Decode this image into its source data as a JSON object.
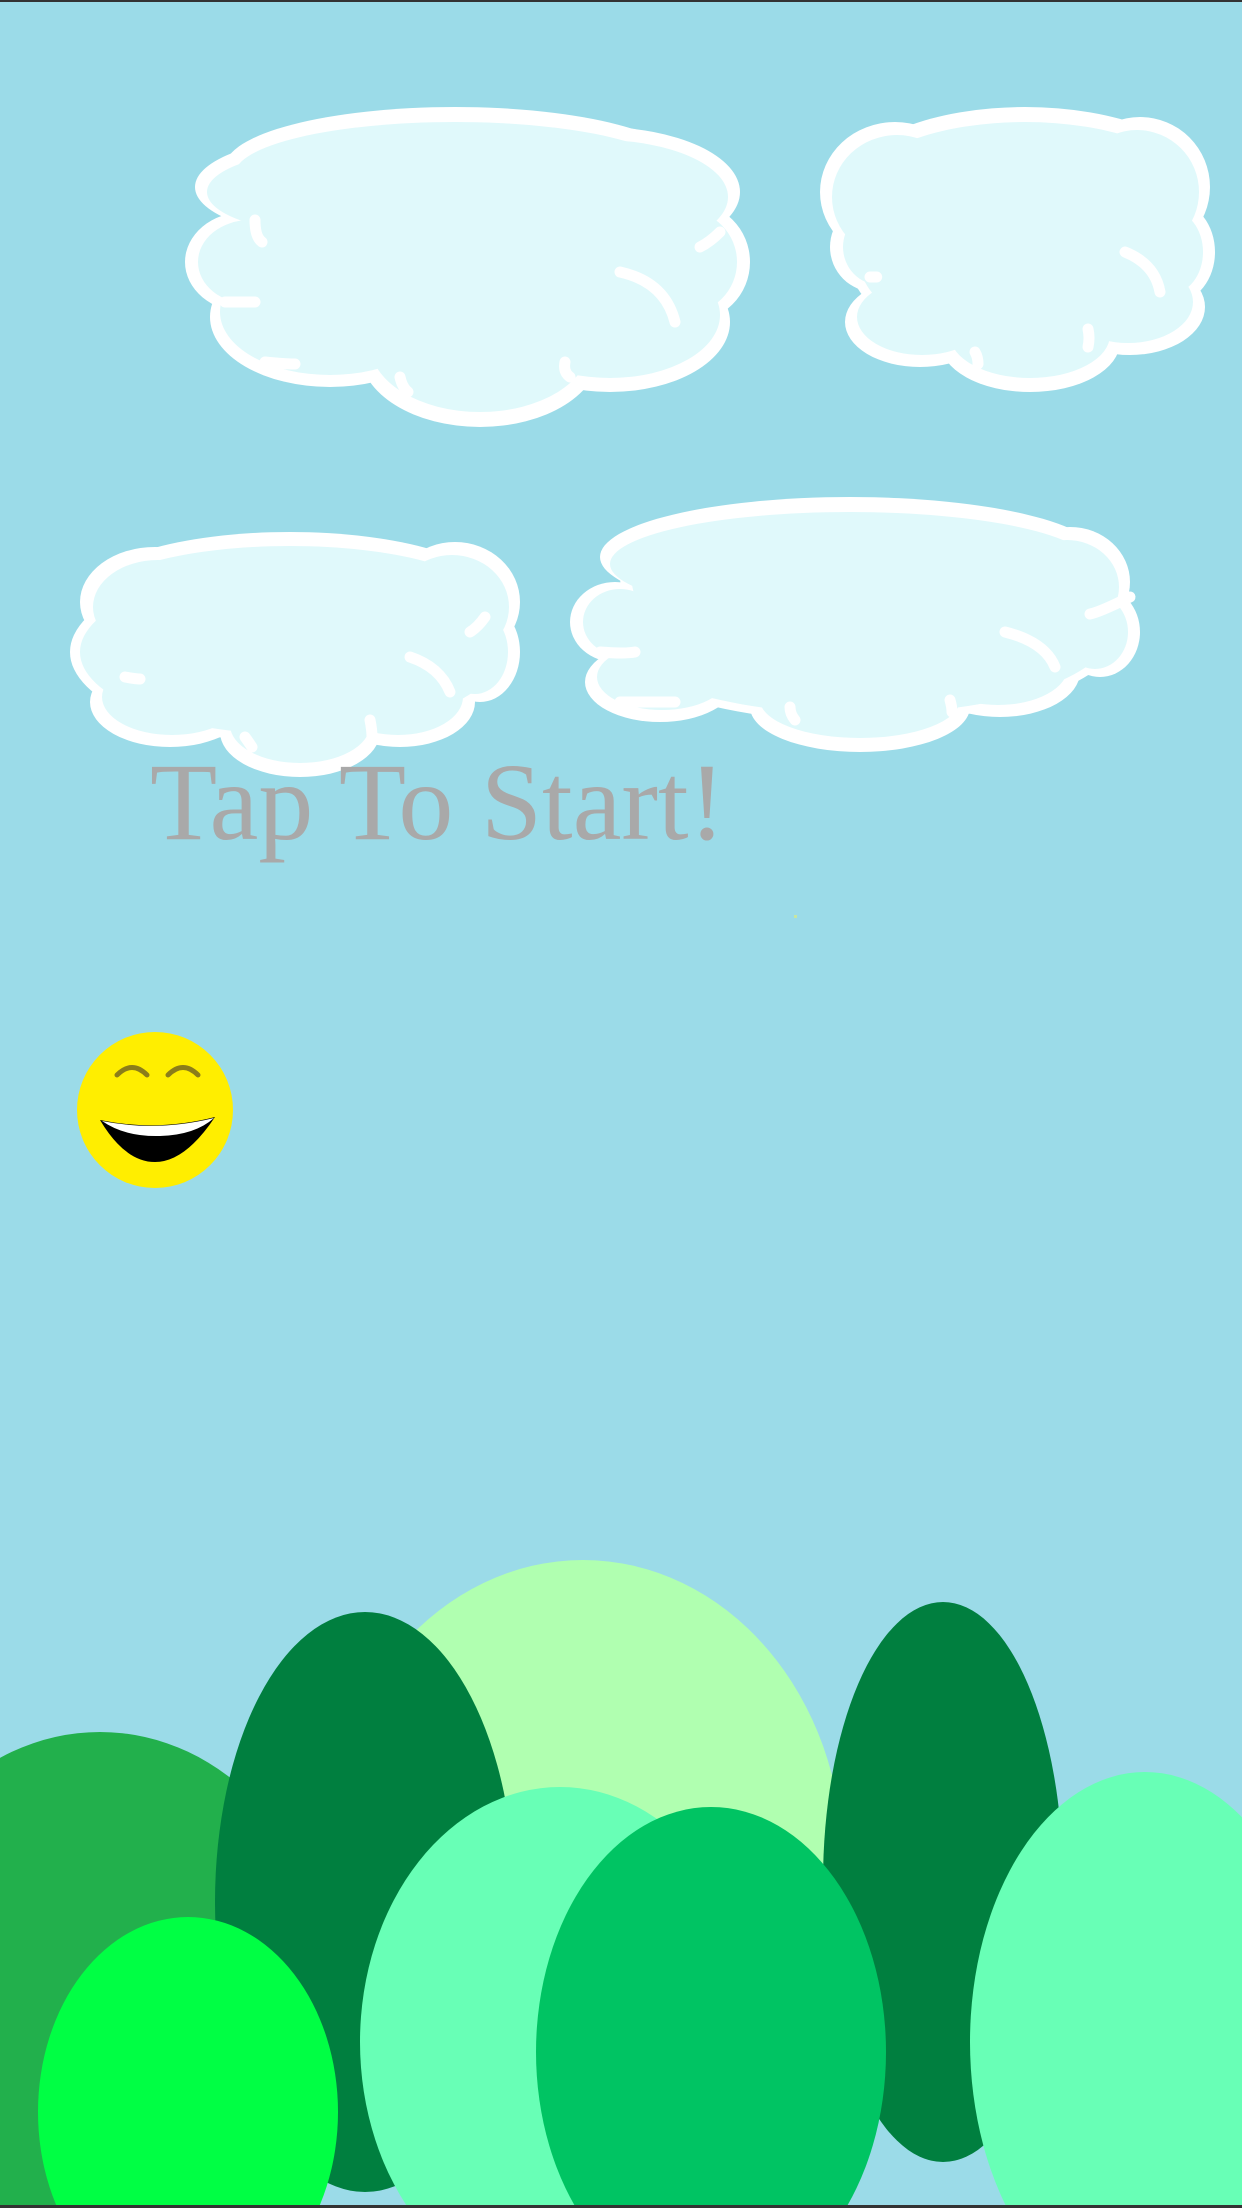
{
  "screen": {
    "prompt_text": "Tap To Start!"
  },
  "colors": {
    "sky": "#9bdbe8",
    "prompt_text": "#a9a9a9",
    "cloud_fill": "#e0f9fb",
    "cloud_outline": "#ffffff",
    "player_face": "#ffee00",
    "player_eyes": "#8b7d1a",
    "player_mouth": "#000000",
    "player_teeth": "#ffffff",
    "hill_light_green": "#b0ffb0",
    "hill_dark_green": "#007f3f",
    "hill_medium_green": "#22b04c",
    "hill_mint": "#68ffb6",
    "hill_emerald": "#00c463",
    "hill_bright_green": "#00ff44"
  },
  "sprites": {
    "player": "smiley-face-ball",
    "clouds": "cloud",
    "ground": "rolling-green-hills"
  }
}
